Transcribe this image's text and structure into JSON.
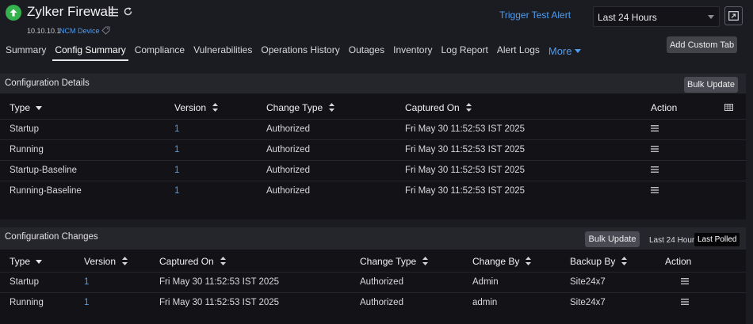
{
  "header": {
    "title": "Zylker Firewall",
    "ip": "10.10.10.1",
    "device_type": "NCM Device",
    "trigger_label": "Trigger Test Alert",
    "time_range": "Last 24 Hours",
    "add_tab_label": "Add Custom Tab",
    "status_color": "#35b24d"
  },
  "tabs": [
    "Summary",
    "Config Summary",
    "Compliance",
    "Vulnerabilities",
    "Operations History",
    "Outages",
    "Inventory",
    "Log Report",
    "Alert Logs"
  ],
  "active_tab": "Config Summary",
  "more_label": "More",
  "config_details": {
    "title": "Configuration Details",
    "bulk_label": "Bulk Update",
    "columns": {
      "type": "Type",
      "version": "Version",
      "change_type": "Change Type",
      "captured_on": "Captured On",
      "action": "Action"
    },
    "rows": [
      {
        "type": "Startup",
        "version": "1",
        "change_type": "Authorized",
        "captured_on": "Fri May 30 11:52:53 IST 2025"
      },
      {
        "type": "Running",
        "version": "1",
        "change_type": "Authorized",
        "captured_on": "Fri May 30 11:52:53 IST 2025"
      },
      {
        "type": "Startup-Baseline",
        "version": "1",
        "change_type": "Authorized",
        "captured_on": "Fri May 30 11:52:53 IST 2025"
      },
      {
        "type": "Running-Baseline",
        "version": "1",
        "change_type": "Authorized",
        "captured_on": "Fri May 30 11:52:53 IST 2025"
      }
    ]
  },
  "config_changes": {
    "title": "Configuration Changes",
    "bulk_label": "Bulk Update",
    "toggle_24h": "Last 24 Hours",
    "toggle_polled": "Last Polled",
    "columns": {
      "type": "Type",
      "version": "Version",
      "captured_on": "Captured On",
      "change_type": "Change Type",
      "change_by": "Change By",
      "backup_by": "Backup By",
      "action": "Action"
    },
    "rows": [
      {
        "type": "Startup",
        "version": "1",
        "captured_on": "Fri May 30 11:52:53 IST 2025",
        "change_type": "Authorized",
        "change_by": "Admin",
        "backup_by": "Site24x7"
      },
      {
        "type": "Running",
        "version": "1",
        "captured_on": "Fri May 30 11:52:53 IST 2025",
        "change_type": "Authorized",
        "change_by": "admin",
        "backup_by": "Site24x7"
      }
    ]
  }
}
